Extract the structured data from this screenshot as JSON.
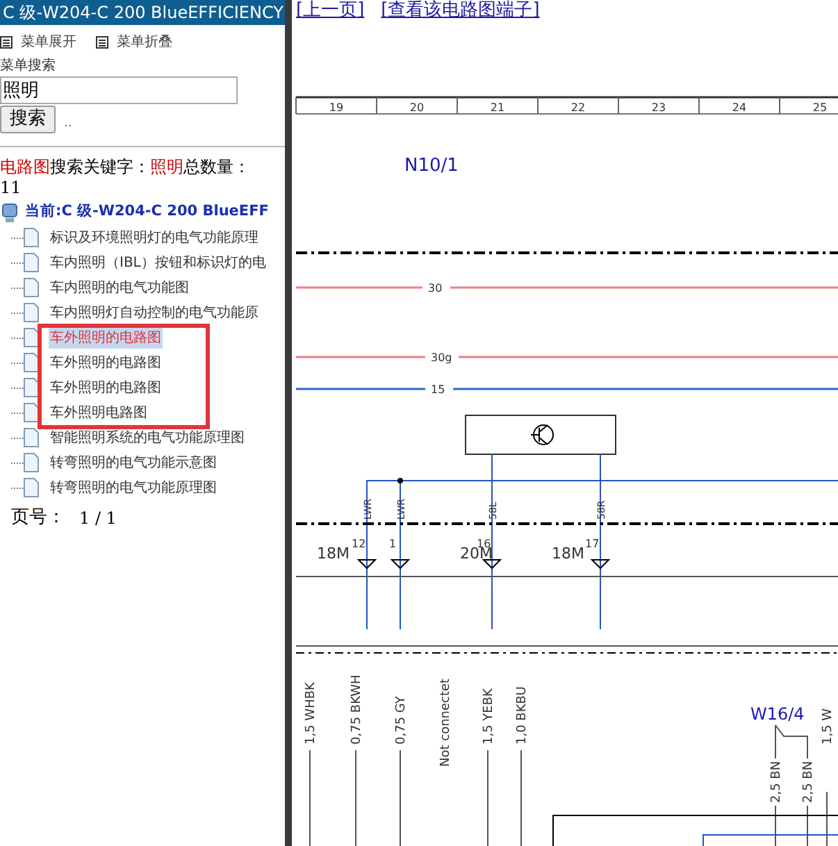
{
  "left_panel": {
    "title": "C 级-W204-C 200 BlueEFFICIENCY",
    "menu_actions": [
      "菜单展开",
      "菜单折叠"
    ],
    "search": {
      "label": "菜单搜索",
      "value": "照明",
      "button": "搜索",
      "extra": ".."
    },
    "result_header": {
      "category": "电路图",
      "keyword_label": "搜索关键字：",
      "keyword": "照明",
      "count_label": "总数量：",
      "count": "11"
    },
    "tree": {
      "root": "当前:C 级-W204-C 200 BlueEFF",
      "items": [
        {
          "label": "标识及环境照明灯的电气功能原理",
          "selected": false,
          "boxed": false
        },
        {
          "label": "车内照明（IBL）按钮和标识灯的电",
          "selected": false,
          "boxed": false
        },
        {
          "label": "车内照明的电气功能图",
          "selected": false,
          "boxed": false
        },
        {
          "label": "车内照明灯自动控制的电气功能原",
          "selected": false,
          "boxed": false
        },
        {
          "label": "车外照明的电路图",
          "selected": true,
          "boxed": true
        },
        {
          "label": "车外照明的电路图",
          "selected": false,
          "boxed": true
        },
        {
          "label": "车外照明的电路图",
          "selected": false,
          "boxed": true
        },
        {
          "label": "车外照明电路图",
          "selected": false,
          "boxed": true
        },
        {
          "label": "智能照明系统的电气功能原理图",
          "selected": false,
          "boxed": false
        },
        {
          "label": "转弯照明的电气功能示意图",
          "selected": false,
          "boxed": false
        },
        {
          "label": "转弯照明的电气功能原理图",
          "selected": false,
          "boxed": false
        }
      ]
    },
    "pager": {
      "label": "页号：",
      "value": "1 / 1"
    }
  },
  "content": {
    "links": [
      "[上一页]",
      "[查看该电路图端子]"
    ],
    "diagram": {
      "columns": [
        "19",
        "20",
        "21",
        "22",
        "23",
        "24",
        "25"
      ],
      "component": "N10/1",
      "bus_lines": [
        {
          "label": "30",
          "color": "#f08080"
        },
        {
          "label": "30g",
          "color": "#f08080"
        },
        {
          "label": "15",
          "color": "#3366dd"
        }
      ],
      "connectors": [
        {
          "signal": "LWR",
          "pin": "12"
        },
        {
          "signal": "LWR",
          "pin": "1"
        },
        {
          "signal": "58L",
          "pin": "16"
        },
        {
          "signal": "58R",
          "pin": "17"
        }
      ],
      "grounds": [
        "18M",
        "20M",
        "18M"
      ],
      "wires": [
        "1,5 WHBK",
        "0,75 BKWH",
        "0,75 GY",
        "Not connectet",
        "1,5 YEBK",
        "1,0 BKBU",
        "1,5 W"
      ],
      "harness": "W16/4",
      "harness_wires": [
        "2,5 BN",
        "2,5 BN"
      ]
    }
  }
}
